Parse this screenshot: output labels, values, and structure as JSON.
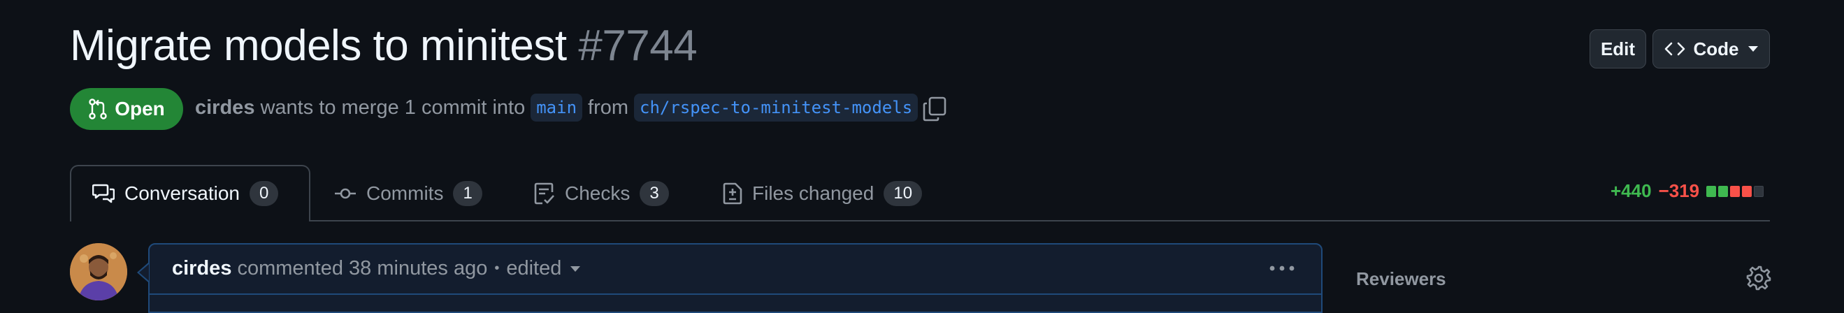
{
  "pr": {
    "title": "Migrate models to minitest",
    "number": "#7744",
    "state_label": "Open",
    "author": "cirdes",
    "merge_text": "wants to merge 1 commit into",
    "base_branch": "main",
    "from_text": "from",
    "head_branch": "ch/rspec-to-minitest-models"
  },
  "header_actions": {
    "edit_label": "Edit",
    "code_label": "Code"
  },
  "tabs": [
    {
      "label": "Conversation",
      "count": "0",
      "icon": "conversation-icon",
      "active": true
    },
    {
      "label": "Commits",
      "count": "1",
      "icon": "commit-icon",
      "active": false
    },
    {
      "label": "Checks",
      "count": "3",
      "icon": "checklist-icon",
      "active": false
    },
    {
      "label": "Files changed",
      "count": "10",
      "icon": "file-diff-icon",
      "active": false
    }
  ],
  "diffstat": {
    "additions": "+440",
    "deletions": "−319",
    "blocks": [
      "#3fb950",
      "#3fb950",
      "#f85149",
      "#f85149",
      "#2f353d"
    ]
  },
  "comment": {
    "author": "cirdes",
    "action_text": "commented 38 minutes ago",
    "separator": "•",
    "edited_label": "edited"
  },
  "sidebar": {
    "reviewers_label": "Reviewers"
  },
  "colors": {
    "background": "#0d1117",
    "open_green": "#238636",
    "link_blue": "#4493f8",
    "addition": "#3fb950",
    "deletion": "#f85149"
  }
}
